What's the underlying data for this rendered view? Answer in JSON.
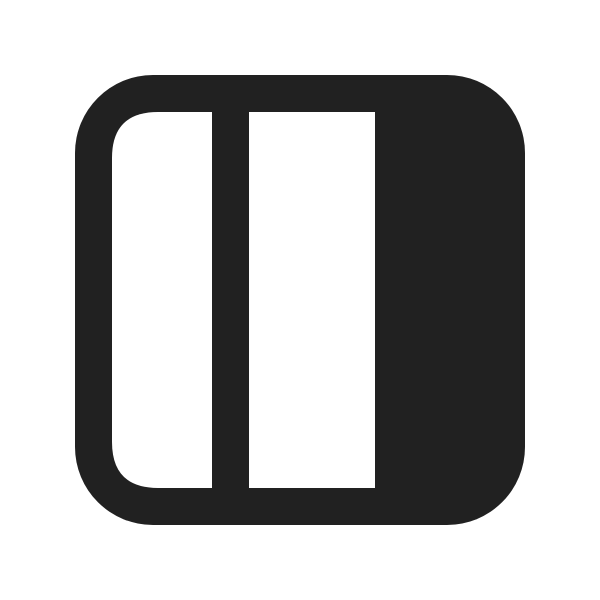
{
  "icon": {
    "name": "panel-layout-right-filled-icon",
    "colors": {
      "foreground": "#212121",
      "background": "#ffffff"
    }
  }
}
